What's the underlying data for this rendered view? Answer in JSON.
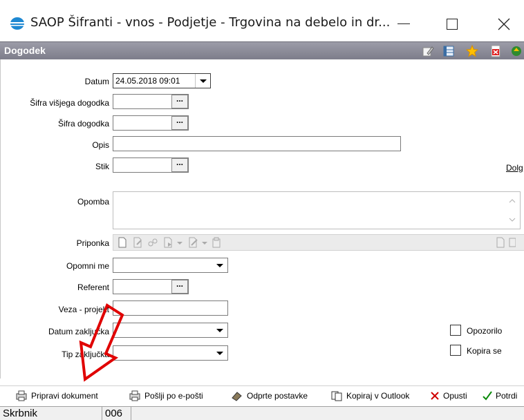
{
  "window": {
    "title": "SAOP Šifranti - vnos - Podjetje - Trgovina na debelo in dr..."
  },
  "header": {
    "title": "Dogodek",
    "icons": [
      "edit-icon",
      "grid-icon",
      "star-icon",
      "pdf-icon",
      "recycle-icon"
    ]
  },
  "form": {
    "datum": {
      "label": "Datum",
      "value": "24.05.2018 09:01"
    },
    "sifra_visjega": {
      "label": "Šifra višjega dogodka",
      "value": ""
    },
    "sifra_dogodka": {
      "label": "Šifra dogodka",
      "value": ""
    },
    "opis": {
      "label": "Opis",
      "value": ""
    },
    "stik": {
      "label": "Stik",
      "value": ""
    },
    "dolg_label": "Dolg",
    "opomba": {
      "label": "Opomba",
      "value": ""
    },
    "priponka": {
      "label": "Priponka"
    },
    "opomni_me": {
      "label": "Opomni me",
      "value": ""
    },
    "referent": {
      "label": "Referent",
      "value": ""
    },
    "veza_projekt": {
      "label": "Veza - projekt",
      "value": ""
    },
    "datum_zakljucka": {
      "label": "Datum zaključka",
      "value": ""
    },
    "tip_zakljucka": {
      "label": "Tip zaključka",
      "value": ""
    },
    "opozorilo": {
      "label": "Opozorilo",
      "checked": false
    },
    "kopira_se": {
      "label": "Kopira se",
      "checked": false
    },
    "dots": "..."
  },
  "actions": {
    "pripravi": "Pripravi dokument",
    "poslji": "Pošlji po e-pošti",
    "odprte": "Odprte postavke",
    "kopiraj": "Kopiraj v Outlook",
    "opusti": "Opusti",
    "potrdi": "Potrdi"
  },
  "status": {
    "user": "Skrbnik",
    "code": "006"
  },
  "colors": {
    "header_bg": "#8a8a96",
    "arrow": "#e00000"
  }
}
